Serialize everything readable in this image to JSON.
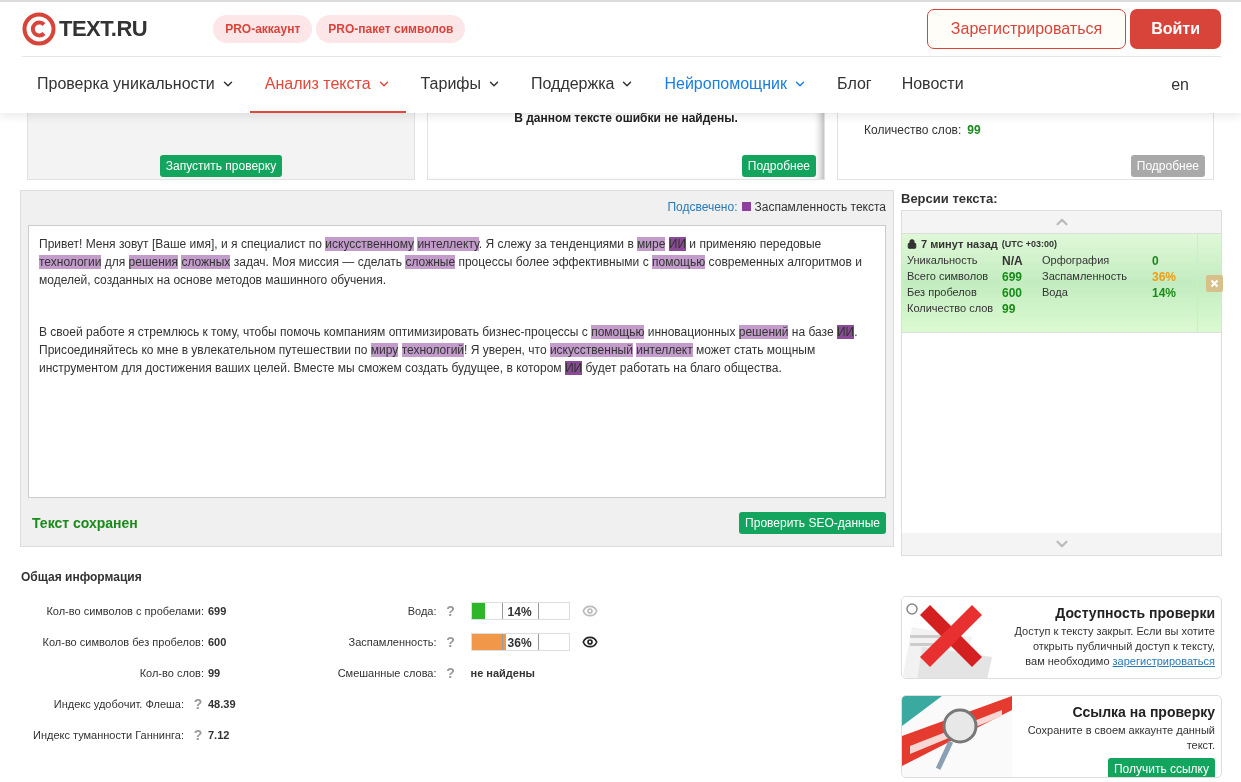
{
  "header": {
    "logo": "TEXT.RU",
    "pro_links": [
      "PRO-аккаунт",
      "PRO-пакет символов"
    ],
    "register_button": "Зарегистрироваться",
    "login_button": "Войти"
  },
  "nav": {
    "items": [
      {
        "label": "Проверка уникальности",
        "selected": false,
        "kind": "plain",
        "dropdown": true
      },
      {
        "label": "Анализ текста",
        "selected": true,
        "kind": "plain",
        "dropdown": true
      },
      {
        "label": "Тарифы",
        "selected": false,
        "kind": "plain",
        "dropdown": true
      },
      {
        "label": "Поддержка",
        "selected": false,
        "kind": "plain",
        "dropdown": true
      },
      {
        "label": "Нейропомощник",
        "selected": false,
        "kind": "ai",
        "dropdown": true
      },
      {
        "label": "Блог",
        "selected": false,
        "kind": "plain",
        "dropdown": false
      },
      {
        "label": "Новости",
        "selected": false,
        "kind": "plain",
        "dropdown": false
      }
    ],
    "language": "en"
  },
  "top_cards": [
    {
      "kind": "run",
      "button": {
        "label": "Запустить проверку",
        "disabled": false
      }
    },
    {
      "kind": "spelling",
      "message": "В данном тексте ошибки не найдены.",
      "button": {
        "label": "Подробнее",
        "disabled": false
      }
    },
    {
      "kind": "stats",
      "stats": [
        {
          "label": "Количество слов:",
          "value": "99"
        }
      ],
      "button": {
        "label": "Подробнее",
        "disabled": true
      }
    }
  ],
  "editor": {
    "legend_label": "Подсвечено:",
    "legend_text": "Заспамленность текста",
    "paragraphs": [
      [
        {
          "text": "Привет! Меня зовут [Ваше имя], и я специалист по ",
          "kind": "plain"
        },
        {
          "text": "искусственному",
          "kind": "spam"
        },
        {
          "text": "интеллекту",
          "kind": "spam"
        },
        {
          "text": ". Я слежу за тенденциями в ",
          "kind": "plain"
        },
        {
          "text": "мире",
          "kind": "spam"
        },
        {
          "text": "ИИ",
          "kind": "strong"
        },
        {
          "text": " и применяю передовые ",
          "kind": "plain"
        },
        {
          "text": "технологии",
          "kind": "spam"
        },
        {
          "text": " для ",
          "kind": "plain"
        },
        {
          "text": "решения",
          "kind": "spam"
        },
        {
          "text": "сложных",
          "kind": "spam"
        },
        {
          "text": " задач. Моя миссия — сделать ",
          "kind": "plain"
        },
        {
          "text": "сложные",
          "kind": "spam"
        },
        {
          "text": " процессы более эффективными с ",
          "kind": "plain"
        },
        {
          "text": "помощью",
          "kind": "spam"
        },
        {
          "text": " современных алгоритмов и моделей, созданных на основе методов машинного обучения.",
          "kind": "plain"
        }
      ],
      [
        {
          "text": "В своей работе я стремлюсь к тому, чтобы помочь компаниям оптимизировать бизнес-процессы с ",
          "kind": "plain"
        },
        {
          "text": "помощью",
          "kind": "spam"
        },
        {
          "text": " инновационных ",
          "kind": "plain"
        },
        {
          "text": "решений",
          "kind": "spam"
        },
        {
          "text": " на базе ",
          "kind": "plain"
        },
        {
          "text": "ИИ",
          "kind": "strong"
        },
        {
          "text": ". Присоединяйтесь ко мне в увлекательном путешествии по ",
          "kind": "plain"
        },
        {
          "text": "миру",
          "kind": "spam"
        },
        {
          "text": "технологий",
          "kind": "spam"
        },
        {
          "text": "! Я уверен, что ",
          "kind": "plain"
        },
        {
          "text": "искусственный",
          "kind": "spam"
        },
        {
          "text": "интеллект",
          "kind": "spam"
        },
        {
          "text": " может стать мощным инструментом для достижения ваших целей. Вместе мы сможем создать будущее, в котором ",
          "kind": "plain"
        },
        {
          "text": "ИИ",
          "kind": "strong"
        },
        {
          "text": " будет работать на благо общества.",
          "kind": "plain"
        }
      ]
    ],
    "status": "Текст сохранен",
    "seo_button": "Проверить SEO-данные"
  },
  "versions": {
    "title": "Версии текста:",
    "items": [
      {
        "time": "7 минут назад",
        "timezone": "(UTC +03:00)",
        "selected": true,
        "stats": [
          {
            "label": "Уникальность",
            "value": "N/A",
            "color": "#333333"
          },
          {
            "label": "Орфография",
            "value": "0",
            "color": "#1a8a1a"
          },
          {
            "label": "Всего символов",
            "value": "699",
            "color": "#1a8a1a"
          },
          {
            "label": "Заспамленность",
            "value": "36%",
            "color": "#f39c12"
          },
          {
            "label": "Без пробелов",
            "value": "600",
            "color": "#1a8a1a"
          },
          {
            "label": "Вода",
            "value": "14%",
            "color": "#1a8a1a"
          },
          {
            "label": "Количество слов",
            "value": "99",
            "color": "#1a8a1a"
          }
        ]
      }
    ]
  },
  "general": {
    "title": "Общая информация",
    "left": [
      {
        "label": "Кол-во символов с пробелами:",
        "value": "699"
      },
      {
        "label": "Кол-во символов без пробелов:",
        "value": "600"
      },
      {
        "label": "Кол-во слов:",
        "value": "99"
      },
      {
        "label": "Индекс удобочит. Флеша:",
        "help": "?",
        "value": "48.39"
      },
      {
        "label": "Индекс туманности Ганнинга:",
        "help": "?",
        "value": "7.12"
      }
    ],
    "right": [
      {
        "kind": "meter",
        "label": "Вода:",
        "help": "?",
        "level": 0.14,
        "reading": "14%",
        "color": "#2fb52a",
        "highlighted": false
      },
      {
        "kind": "meter",
        "label": "Заспамленность:",
        "help": "?",
        "level": 0.36,
        "reading": "36%",
        "color": "#f0974a",
        "highlighted": true
      },
      {
        "kind": "text",
        "label": "Смешанные слова:",
        "help": "?",
        "value": "не найдены"
      }
    ]
  },
  "promo_cards": [
    {
      "kind": "access",
      "title": "Доступность проверки",
      "text": "Доступ к тексту закрыт. Если вы хотите открыть публичный доступ к тексту, вам необходимо",
      "link": "зарегистрироваться"
    },
    {
      "kind": "share",
      "title": "Ссылка на проверку",
      "text": "Сохраните в своем аккаунте данный текст.",
      "button": "Получить ссылку"
    }
  ]
}
